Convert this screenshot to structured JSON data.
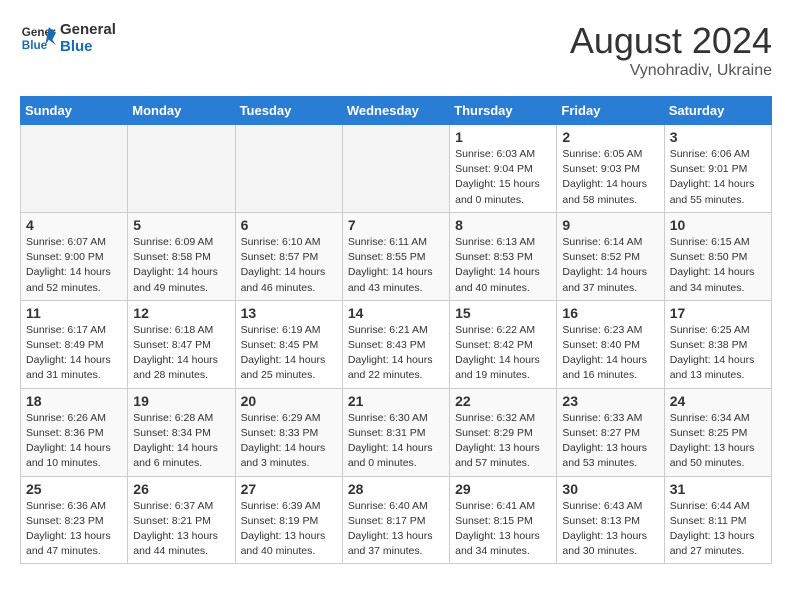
{
  "header": {
    "logo_line1": "General",
    "logo_line2": "Blue",
    "month": "August 2024",
    "location": "Vynohradiv, Ukraine"
  },
  "weekdays": [
    "Sunday",
    "Monday",
    "Tuesday",
    "Wednesday",
    "Thursday",
    "Friday",
    "Saturday"
  ],
  "weeks": [
    [
      {
        "day": "",
        "info": ""
      },
      {
        "day": "",
        "info": ""
      },
      {
        "day": "",
        "info": ""
      },
      {
        "day": "",
        "info": ""
      },
      {
        "day": "1",
        "info": "Sunrise: 6:03 AM\nSunset: 9:04 PM\nDaylight: 15 hours\nand 0 minutes."
      },
      {
        "day": "2",
        "info": "Sunrise: 6:05 AM\nSunset: 9:03 PM\nDaylight: 14 hours\nand 58 minutes."
      },
      {
        "day": "3",
        "info": "Sunrise: 6:06 AM\nSunset: 9:01 PM\nDaylight: 14 hours\nand 55 minutes."
      }
    ],
    [
      {
        "day": "4",
        "info": "Sunrise: 6:07 AM\nSunset: 9:00 PM\nDaylight: 14 hours\nand 52 minutes."
      },
      {
        "day": "5",
        "info": "Sunrise: 6:09 AM\nSunset: 8:58 PM\nDaylight: 14 hours\nand 49 minutes."
      },
      {
        "day": "6",
        "info": "Sunrise: 6:10 AM\nSunset: 8:57 PM\nDaylight: 14 hours\nand 46 minutes."
      },
      {
        "day": "7",
        "info": "Sunrise: 6:11 AM\nSunset: 8:55 PM\nDaylight: 14 hours\nand 43 minutes."
      },
      {
        "day": "8",
        "info": "Sunrise: 6:13 AM\nSunset: 8:53 PM\nDaylight: 14 hours\nand 40 minutes."
      },
      {
        "day": "9",
        "info": "Sunrise: 6:14 AM\nSunset: 8:52 PM\nDaylight: 14 hours\nand 37 minutes."
      },
      {
        "day": "10",
        "info": "Sunrise: 6:15 AM\nSunset: 8:50 PM\nDaylight: 14 hours\nand 34 minutes."
      }
    ],
    [
      {
        "day": "11",
        "info": "Sunrise: 6:17 AM\nSunset: 8:49 PM\nDaylight: 14 hours\nand 31 minutes."
      },
      {
        "day": "12",
        "info": "Sunrise: 6:18 AM\nSunset: 8:47 PM\nDaylight: 14 hours\nand 28 minutes."
      },
      {
        "day": "13",
        "info": "Sunrise: 6:19 AM\nSunset: 8:45 PM\nDaylight: 14 hours\nand 25 minutes."
      },
      {
        "day": "14",
        "info": "Sunrise: 6:21 AM\nSunset: 8:43 PM\nDaylight: 14 hours\nand 22 minutes."
      },
      {
        "day": "15",
        "info": "Sunrise: 6:22 AM\nSunset: 8:42 PM\nDaylight: 14 hours\nand 19 minutes."
      },
      {
        "day": "16",
        "info": "Sunrise: 6:23 AM\nSunset: 8:40 PM\nDaylight: 14 hours\nand 16 minutes."
      },
      {
        "day": "17",
        "info": "Sunrise: 6:25 AM\nSunset: 8:38 PM\nDaylight: 14 hours\nand 13 minutes."
      }
    ],
    [
      {
        "day": "18",
        "info": "Sunrise: 6:26 AM\nSunset: 8:36 PM\nDaylight: 14 hours\nand 10 minutes."
      },
      {
        "day": "19",
        "info": "Sunrise: 6:28 AM\nSunset: 8:34 PM\nDaylight: 14 hours\nand 6 minutes."
      },
      {
        "day": "20",
        "info": "Sunrise: 6:29 AM\nSunset: 8:33 PM\nDaylight: 14 hours\nand 3 minutes."
      },
      {
        "day": "21",
        "info": "Sunrise: 6:30 AM\nSunset: 8:31 PM\nDaylight: 14 hours\nand 0 minutes."
      },
      {
        "day": "22",
        "info": "Sunrise: 6:32 AM\nSunset: 8:29 PM\nDaylight: 13 hours\nand 57 minutes."
      },
      {
        "day": "23",
        "info": "Sunrise: 6:33 AM\nSunset: 8:27 PM\nDaylight: 13 hours\nand 53 minutes."
      },
      {
        "day": "24",
        "info": "Sunrise: 6:34 AM\nSunset: 8:25 PM\nDaylight: 13 hours\nand 50 minutes."
      }
    ],
    [
      {
        "day": "25",
        "info": "Sunrise: 6:36 AM\nSunset: 8:23 PM\nDaylight: 13 hours\nand 47 minutes."
      },
      {
        "day": "26",
        "info": "Sunrise: 6:37 AM\nSunset: 8:21 PM\nDaylight: 13 hours\nand 44 minutes."
      },
      {
        "day": "27",
        "info": "Sunrise: 6:39 AM\nSunset: 8:19 PM\nDaylight: 13 hours\nand 40 minutes."
      },
      {
        "day": "28",
        "info": "Sunrise: 6:40 AM\nSunset: 8:17 PM\nDaylight: 13 hours\nand 37 minutes."
      },
      {
        "day": "29",
        "info": "Sunrise: 6:41 AM\nSunset: 8:15 PM\nDaylight: 13 hours\nand 34 minutes."
      },
      {
        "day": "30",
        "info": "Sunrise: 6:43 AM\nSunset: 8:13 PM\nDaylight: 13 hours\nand 30 minutes."
      },
      {
        "day": "31",
        "info": "Sunrise: 6:44 AM\nSunset: 8:11 PM\nDaylight: 13 hours\nand 27 minutes."
      }
    ]
  ]
}
